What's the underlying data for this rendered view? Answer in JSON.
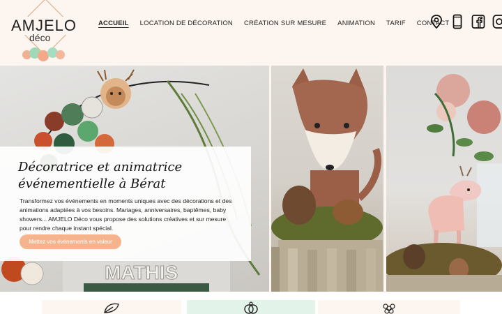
{
  "brand": {
    "name": "AMJELO",
    "sub": "déco",
    "colors": {
      "accent": "#f6b48e",
      "gold": "#d9a77a",
      "mint": "#e2f3ea",
      "cream": "#fdf5ef"
    }
  },
  "nav": {
    "items": [
      {
        "label": "ACCUEIL",
        "active": true
      },
      {
        "label": "LOCATION DE DÉCORATION",
        "active": false
      },
      {
        "label": "CRÉATION SUR MESURE",
        "active": false
      },
      {
        "label": "ANIMATION",
        "active": false
      },
      {
        "label": "TARIF",
        "active": false
      },
      {
        "label": "CONTACT",
        "active": false
      }
    ]
  },
  "social": [
    "map-pin-icon",
    "phone-icon",
    "facebook-icon",
    "instagram-icon"
  ],
  "hero": {
    "title": "Décoratrice et animatrice événementielle à Bérat",
    "description": "Transformez vos événements en moments uniques avec des décorations et des animations adaptées à vos besoins. Mariages, anniversaires, baptêmes, baby showers... AMJELO Déco vous propose des solutions créatives et sur mesure pour rendre chaque instant spécial.",
    "cta": "Mettez vos événements en valeur",
    "photos": [
      "balloon-arch-with-deer-photo",
      "fox-centerpiece-photo",
      "deer-with-roses-photo"
    ]
  },
  "features": [
    "leaf-icon",
    "rings-icon",
    "flower-icon"
  ]
}
